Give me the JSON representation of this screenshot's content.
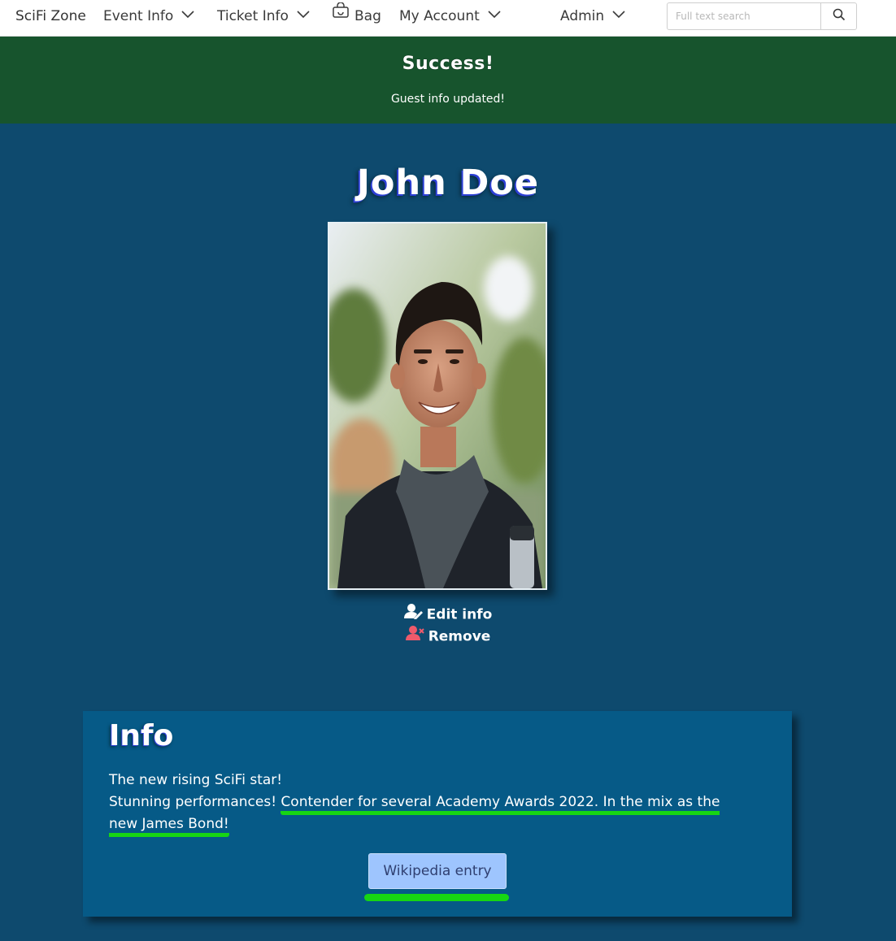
{
  "nav": {
    "brand": "SciFi Zone",
    "items": [
      {
        "label": "Event Info",
        "icon": "chevron-down-icon"
      },
      {
        "label": "Ticket Info",
        "icon": "chevron-down-icon"
      },
      {
        "label": "Bag",
        "icon": "bag-icon"
      },
      {
        "label": "My Account",
        "icon": "chevron-down-icon"
      },
      {
        "label": "Admin",
        "icon": "chevron-down-icon"
      }
    ],
    "search": {
      "placeholder": "Full text search",
      "value": "",
      "icon": "search-icon"
    }
  },
  "alert": {
    "title": "Success!",
    "message": "Guest info updated!",
    "color": "#17542d"
  },
  "guest": {
    "name": "John Doe",
    "actions": {
      "edit": "Edit info",
      "remove": "Remove"
    }
  },
  "info": {
    "title": "Info",
    "line1": "The new rising SciFi star!",
    "line2_plain": "Stunning performances! ",
    "line2_highlight": "Contender for several Academy Awards 2022. In the mix as the new James Bond!",
    "link_label": "Wikipedia entry",
    "highlight_color": "#17d613"
  },
  "colors": {
    "page_background": "#0e4a6e",
    "card_background": "#065a87",
    "button_background": "#9ec5fe"
  }
}
